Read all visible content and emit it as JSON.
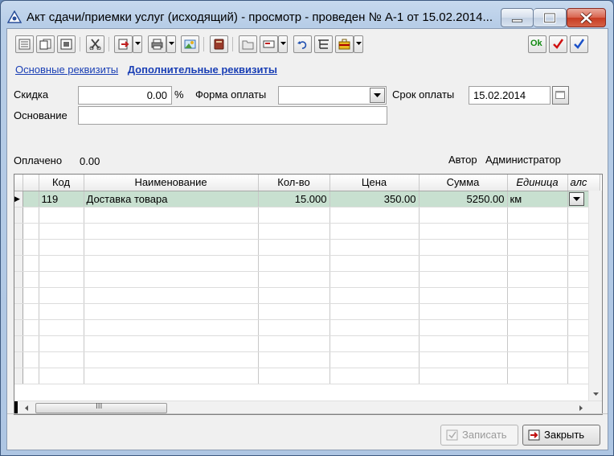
{
  "window": {
    "title": "Акт сдачи/приемки услуг (исходящий) - просмотр - проведен № А-1 от 15.02.2014..."
  },
  "toolbar": {
    "ok_label": "Ok"
  },
  "tabs": {
    "main": "Основные реквизиты",
    "additional": "Дополнительные реквизиты"
  },
  "form": {
    "discount_label": "Скидка",
    "discount_value": "0.00",
    "percent_sign": "%",
    "payment_form_label": "Форма оплаты",
    "payment_form_value": "",
    "due_label": "Срок оплаты",
    "due_value": "15.02.2014",
    "basis_label": "Основание",
    "basis_value": "",
    "paid_label": "Оплачено",
    "paid_value": "0.00",
    "author_label": "Автор",
    "author_value": "Администратор"
  },
  "grid": {
    "columns": [
      "Код",
      "Наименование",
      "Кол-во",
      "Цена",
      "Сумма",
      "Единица",
      "алс"
    ],
    "rows": [
      {
        "code": "119",
        "name": "Доставка товара",
        "qty": "15.000",
        "price": "350.00",
        "sum": "5250.00",
        "unit": "км"
      }
    ],
    "hscroll_grip": "III"
  },
  "buttons": {
    "save": "Записать",
    "close": "Закрыть"
  },
  "colors": {
    "link": "#1a3fb5",
    "selected_row": "#c8e0d0"
  }
}
